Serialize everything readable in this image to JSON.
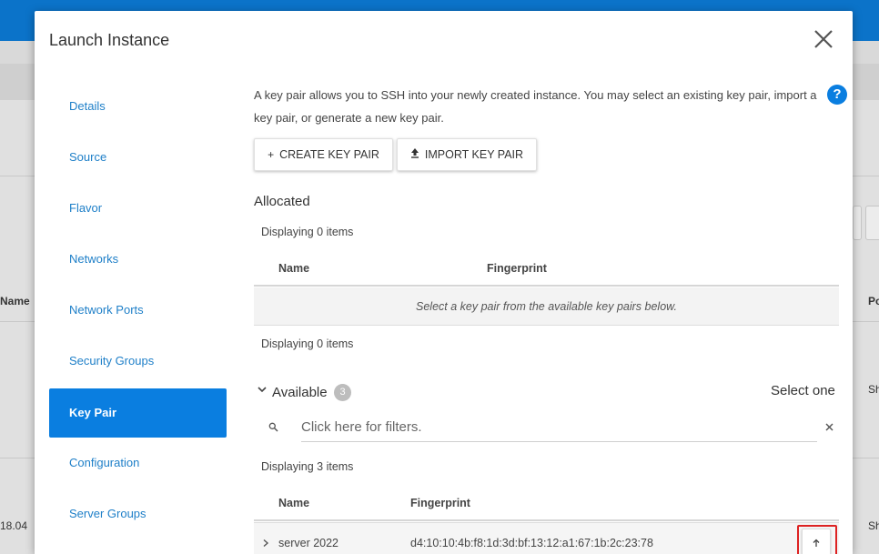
{
  "background": {
    "name_col": "Name",
    "po_col": "Po",
    "sh1": "Sh",
    "sh2": "Sh",
    "version_text": "18.04"
  },
  "modal": {
    "title": "Launch Instance",
    "close_icon": "close-icon"
  },
  "nav": {
    "items": [
      {
        "label": "Details"
      },
      {
        "label": "Source"
      },
      {
        "label": "Flavor"
      },
      {
        "label": "Networks"
      },
      {
        "label": "Network Ports"
      },
      {
        "label": "Security Groups"
      },
      {
        "label": "Key Pair",
        "active": true
      },
      {
        "label": "Configuration"
      },
      {
        "label": "Server Groups"
      }
    ]
  },
  "keypair": {
    "description": "A key pair allows you to SSH into your newly created instance. You may select an existing key pair, import a key pair, or generate a new key pair.",
    "help_icon": "?",
    "create_label": "CREATE KEY PAIR",
    "create_icon": "+",
    "import_label": "IMPORT KEY PAIR",
    "import_icon": "upload-icon"
  },
  "allocated": {
    "title": "Allocated",
    "displaying_top": "Displaying 0 items",
    "columns": [
      "Name",
      "Fingerprint"
    ],
    "empty_message": "Select a key pair from the available key pairs below.",
    "displaying_bottom": "Displaying 0 items"
  },
  "available": {
    "title": "Available",
    "count": "3",
    "select_hint": "Select one",
    "filter_placeholder": "Click here for filters.",
    "displaying": "Displaying 3 items",
    "columns": [
      "Name",
      "Fingerprint"
    ],
    "rows": [
      {
        "name": "server 2022",
        "fingerprint": "d4:10:10:4b:f8:1d:3d:bf:13:12:a1:67:1b:2c:23:78"
      }
    ]
  },
  "colors": {
    "accent": "#0a7ee0",
    "link": "#1e7fc8",
    "highlight_outline": "#dd2222"
  }
}
